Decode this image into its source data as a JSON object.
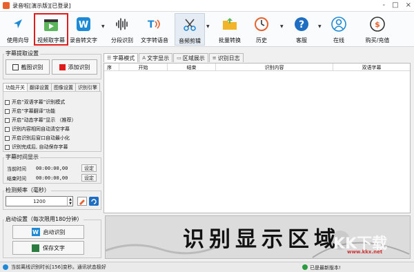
{
  "window": {
    "title": "录音啦[演示版][已登录]",
    "controls": [
      "-",
      "□",
      "×"
    ]
  },
  "toolbar": {
    "items": [
      {
        "label": "使用向导",
        "icon": "cursor-arrow-icon"
      },
      {
        "label": "视频取字幕",
        "icon": "video-play-icon",
        "selected": true
      },
      {
        "label": "录音转文字",
        "icon": "w-logo-icon",
        "has_dropdown": true
      },
      {
        "label": "分段识别",
        "icon": "waveform-icon"
      },
      {
        "label": "文字转语音",
        "icon": "text-speech-icon"
      },
      {
        "label": "音频剪辑",
        "icon": "scissors-icon",
        "has_dropdown": true
      },
      {
        "label": "批量转换",
        "icon": "folder-icon"
      },
      {
        "label": "历史",
        "icon": "history-clock-icon",
        "has_dropdown": true
      },
      {
        "label": "客服",
        "icon": "help-question-icon",
        "has_dropdown": true
      },
      {
        "label": "在线",
        "icon": "user-online-icon"
      },
      {
        "label": "购买/充值",
        "icon": "purchase-dollar-icon"
      }
    ]
  },
  "subtitle_settings": {
    "title": "字幕提取设置",
    "screenshot_button": "截图识别",
    "add_button": "添加识别"
  },
  "settings_tabs": [
    "功能开关",
    "翻译设置",
    "图像设置",
    "识别引擎"
  ],
  "options": [
    "开启“双语字幕”识别模式",
    "开启“字幕翻译”功能",
    "开启“动态字幕”显示  （推荐）",
    "识别内容相同自动清空字幕",
    "开启识别后窗口自动最小化",
    "识别完成后, 自动保存字幕"
  ],
  "time_display": {
    "title": "字幕时间显示",
    "start_label": "当前时间",
    "start_value": "00:00:00,00",
    "end_label": "结束时间",
    "end_value": "00:00:00,00",
    "set_label": "设定"
  },
  "frequency": {
    "title": "检测频率（毫秒）",
    "value": "1200"
  },
  "launch": {
    "title": "启动设置（每次限用180分钟）",
    "start_button": "启动识别",
    "save_button": "保存文字"
  },
  "main_tabs": [
    {
      "label": "字幕模式",
      "icon": "list-icon"
    },
    {
      "label": "文字显示",
      "icon": "text-a-icon"
    },
    {
      "label": "区域展示",
      "icon": "region-icon"
    },
    {
      "label": "识别日志",
      "icon": "log-icon"
    }
  ],
  "table": {
    "columns": [
      "序",
      "开始",
      "结束",
      "识别内容",
      "双语字幕"
    ]
  },
  "display_area": {
    "text": "识别显示区域",
    "watermark": "KK下载",
    "watermark_url": "www.kkx.net"
  },
  "status": {
    "left": "当前离线识别时长[156]变秒。通讯状态极好",
    "right": "已是最新版本!"
  },
  "colors": {
    "accent_red": "#e01b1b",
    "brand_blue": "#1e8ad6",
    "brand_orange": "#e8612c"
  }
}
